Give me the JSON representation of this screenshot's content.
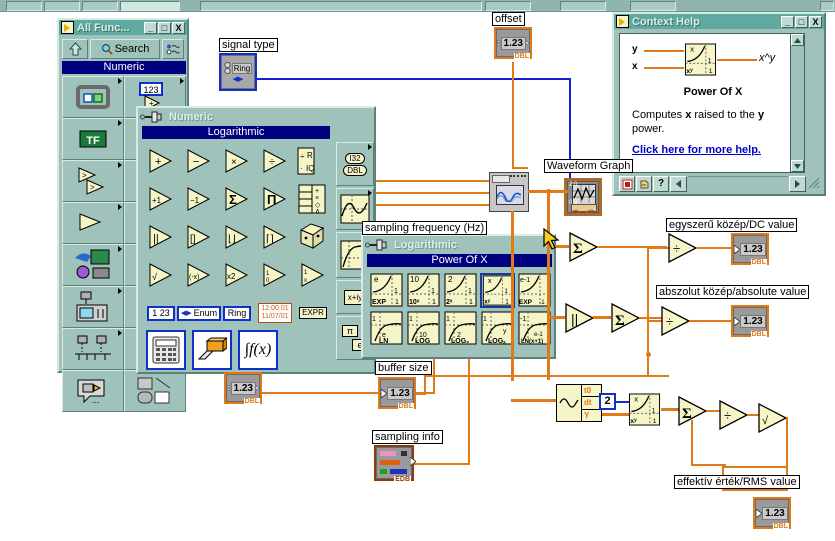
{
  "app": {
    "functions_palette": {
      "title": "All Func...",
      "icon": "labview-icon",
      "buttons": {
        "minimize": "_",
        "maximize": "□",
        "close": "X"
      },
      "toolbar": {
        "up_icon": "up-arrow-icon",
        "search_label": "Search",
        "options_icon": "options-icon"
      },
      "category_header": "Numeric",
      "items": [
        "array-cluster-icon",
        "numeric-icon",
        "boolean-icon",
        "string-icon",
        "string-array-icon",
        "comparison-icon",
        "time-dialog-icon",
        "instrument-io-icon",
        "data-acquisition-icon",
        "waveform-icon",
        "analyze-icon",
        "file-io-icon",
        "report-generation-icon",
        "advanced-icon",
        "select-vi-icon"
      ]
    },
    "numeric_palette": {
      "pin_label": "Numeric",
      "header": "Logarithmic",
      "functions": [
        "add",
        "subtract",
        "multiply",
        "divide",
        "quotient-remainder",
        "increment",
        "decrement",
        "add-array-elements",
        "multiply-array-elements",
        "compound-arithmetic",
        "absolute-value",
        "round-to-nearest",
        "round-down",
        "round-up",
        "random-number",
        "scale-by-power-of-2",
        "square-root",
        "negate",
        "reciprocal",
        "sign",
        "square-root-2",
        "negate-2",
        "x-squared",
        "one-over-x",
        "sign-2"
      ],
      "constants": [
        "1 23",
        "Enum",
        "Ring",
        "12:00:01\n11/07/01",
        "EXPR"
      ],
      "bottom_items": [
        "numeric-constant-palette-icon",
        "eraser-icon",
        "formula-icon"
      ],
      "side_items": [
        "I32",
        "DBL",
        "trig-icon",
        "log-icon",
        "complex-icon",
        "pi-icon",
        "e-icon"
      ],
      "side_labels": {
        "i32": "I32",
        "dbl": "DBL",
        "complex": "x+iy",
        "pi": "π",
        "e": "e"
      }
    },
    "logarithmic_palette": {
      "pin_label": "Logarithmic",
      "header": "Power Of X",
      "functions": [
        {
          "name": "exp",
          "top": "e",
          "bottom": "EXP"
        },
        {
          "name": "power-of-10",
          "top": "10",
          "bottom": "10^X"
        },
        {
          "name": "power-of-2",
          "top": "2",
          "bottom": "2^X"
        },
        {
          "name": "power-of-x",
          "top": "x",
          "bottom": "x^y",
          "selected": true
        },
        {
          "name": "exp-minus-1",
          "top": "e-1",
          "bottom": "EXP -1"
        },
        {
          "name": "natural-log",
          "top": "1",
          "bottom": "LN"
        },
        {
          "name": "log-base-10",
          "top": "1",
          "bottom": "LOG"
        },
        {
          "name": "log-base-2",
          "top": "1",
          "bottom": "LOG2"
        },
        {
          "name": "log-base-x",
          "top": "1",
          "bottom": "LOGx"
        },
        {
          "name": "log-x-plus-1",
          "top": "-1",
          "bottom": "LN(x+1)"
        }
      ]
    },
    "context_help": {
      "title": "Context Help",
      "icon": "labview-icon",
      "buttons": {
        "minimize": "_",
        "maximize": "□",
        "close": "X"
      },
      "terminal_left_top": "y",
      "terminal_left_bottom": "x",
      "terminal_right": "x^y",
      "function_title": "Power Of X",
      "description_1": "Computes ",
      "description_x": "x",
      "description_2": " raised to the ",
      "description_y": "y",
      "description_3": " power.",
      "link": "Click here for more help.",
      "footer_buttons": [
        "lock-context-help-icon",
        "detailed-help-icon",
        "help-question-icon",
        "back-arrow-icon",
        "forward-arrow-icon"
      ]
    }
  },
  "diagram": {
    "labels": {
      "signal_type": "signal type",
      "offset": "offset",
      "waveform_graph": "Waveform Graph",
      "sampling_frequency": "sampling frequency  (Hz)",
      "buffer_size": "buffer size",
      "sampling_info": "sampling info",
      "dc_value": "egyszerű közép/DC value",
      "absolute_value": "abszolut közép/absolute value",
      "rms_value": "effektív érték/RMS value"
    },
    "controls": {
      "signal_type_ring": "Ring",
      "offset_value": "1.23",
      "offset_type": "DBL",
      "amplitude_value": "1.23",
      "amplitude_type": "DBL",
      "buffer_size_value": "1.23",
      "buffer_size_type": "DBL",
      "dc_indicator_value": "1.23",
      "dc_indicator_type": "DBL",
      "abs_indicator_value": "1.23",
      "abs_indicator_type": "DBL",
      "rms_indicator_value": "1.23",
      "rms_indicator_type": "DBL"
    },
    "constants": {
      "power_exponent": "2"
    },
    "waveform_cluster": {
      "t0": "t0",
      "dt": "dt",
      "y": "Y"
    },
    "nodes": [
      "simulate-signal-vi",
      "waveform-graph-terminal",
      "sum-array-elements-1",
      "divide-1",
      "absolute-value",
      "sum-array-elements-2",
      "divide-2",
      "unbundle-waveform",
      "power-of-x",
      "sum-array-elements-3",
      "divide-3",
      "square-root"
    ]
  },
  "colors": {
    "window_face": "#9fc2bb",
    "titlebar": "#5fa9a0",
    "palette_header": "#000080",
    "wire_orange": "#e07a18",
    "wire_blue": "#1020d0",
    "icon_cream": "#f5f5c8",
    "selection_blue": "#1030a0"
  }
}
